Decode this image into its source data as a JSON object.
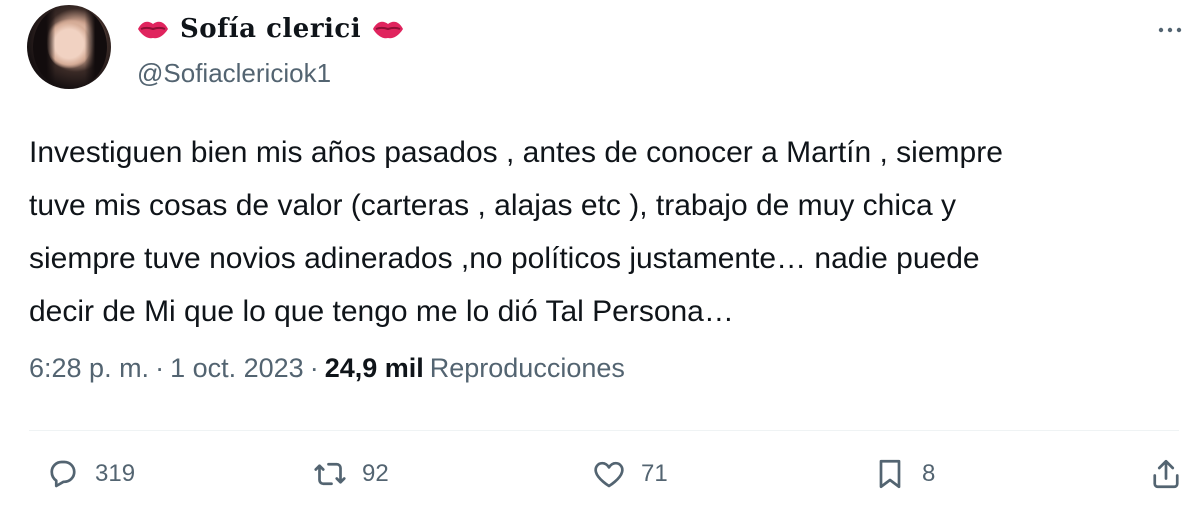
{
  "author": {
    "display_name": "Sofía clerici",
    "handle": "@Sofiaclericiok1"
  },
  "tweet": {
    "text": "Investiguen bien mis años pasados , antes de conocer a Martín , siempre\ntuve mis cosas de valor (carteras , alajas etc ), trabajo de muy chica y\nsiempre tuve novios adinerados ,no políticos justamente… nadie puede\ndecir de Mi que lo que tengo me lo dió Tal Persona…",
    "time": "6:28 p. m.",
    "separator": "·",
    "date": "1 oct. 2023",
    "views_count": "24,9 mil",
    "views_label": "Reproducciones"
  },
  "actions": {
    "replies": "319",
    "retweets": "92",
    "likes": "71",
    "bookmarks": "8"
  },
  "icons": [
    "lips-icon",
    "more-icon",
    "reply-icon",
    "retweet-icon",
    "like-icon",
    "bookmark-icon",
    "share-icon"
  ],
  "colors": {
    "text": "#0f1419",
    "secondary": "#536471",
    "lips": "#e0245e"
  }
}
